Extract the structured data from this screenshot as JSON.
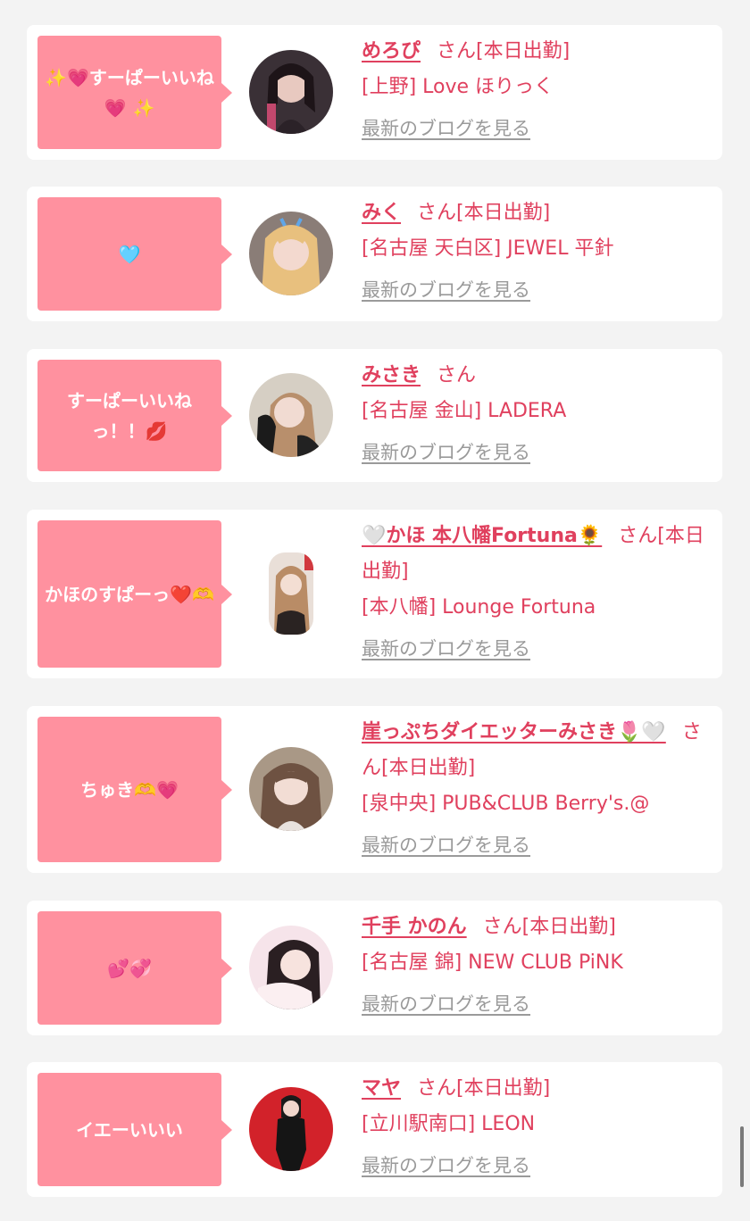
{
  "items": [
    {
      "comment": "✨💗すーぱーいいね💗 ✨",
      "name": "めろぴ",
      "san": "さん[本日出勤]",
      "store": "[上野] Love ほりっく",
      "blog": "最新のブログを見る"
    },
    {
      "comment": "🩵",
      "name": "みく",
      "san": "さん[本日出勤]",
      "store": "[名古屋 天白区] JEWEL 平針",
      "blog": "最新のブログを見る"
    },
    {
      "comment": "すーぱーいいねっ！！💋",
      "name": "みさき",
      "san": "さん",
      "store": "[名古屋 金山] LADERA",
      "blog": "最新のブログを見る"
    },
    {
      "comment": "かほのすぱーっ❤️🫶",
      "name": "🤍かほ 本八幡Fortuna🌻",
      "san": "さん[本日出勤]",
      "store": "[本八幡] Lounge Fortuna",
      "blog": "最新のブログを見る"
    },
    {
      "comment": "ちゅき🫶💗",
      "name": "崖っぷちダイエッターみさき🌷🤍",
      "san": "さん[本日出勤]",
      "store": "[泉中央] PUB&CLUB Berry's.@",
      "blog": "最新のブログを見る"
    },
    {
      "comment": "💕💞",
      "name": "千手 かのん",
      "san": "さん[本日出勤]",
      "store": "[名古屋 錦] NEW CLUB PiNK",
      "blog": "最新のブログを見る"
    },
    {
      "comment": "イエーいいい",
      "name": "マヤ",
      "san": "さん[本日出勤]",
      "store": "[立川駅南口] LEON",
      "blog": "最新のブログを見る"
    }
  ],
  "colors": {
    "accent": "#e0405e",
    "bubble": "#ff919f",
    "link_gray": "#9a9a9a"
  }
}
